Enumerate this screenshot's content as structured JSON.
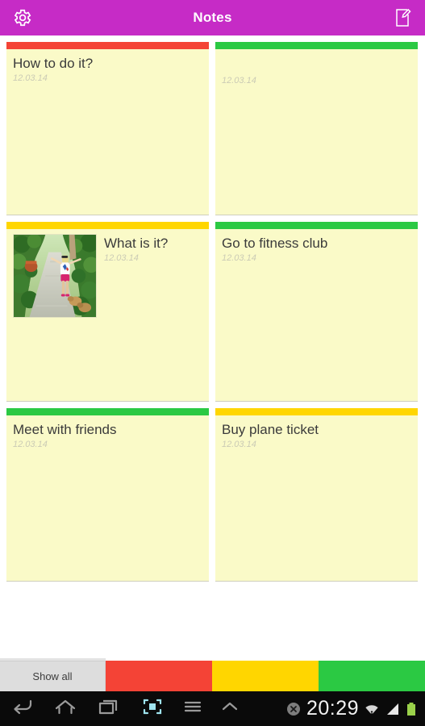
{
  "header": {
    "title": "Notes",
    "settings_icon": "gear-icon",
    "compose_icon": "compose-note-icon",
    "background_color": "#C62BC6"
  },
  "notes": [
    {
      "title": "How to do it?",
      "date": "12.03.14",
      "color": "#F44336",
      "color_name": "red",
      "has_image": false
    },
    {
      "title": "",
      "date": "12.03.14",
      "color": "#2BC943",
      "color_name": "green",
      "has_image": false
    },
    {
      "title": "What is it?",
      "date": "12.03.14",
      "color": "#FFD600",
      "color_name": "yellow",
      "has_image": true,
      "image_alt": "woman walking down a sunlit garden path with dogs"
    },
    {
      "title": "Go to fitness club",
      "date": "12.03.14",
      "color": "#2BC943",
      "color_name": "green",
      "has_image": false
    },
    {
      "title": "Meet with friends",
      "date": "12.03.14",
      "color": "#2BC943",
      "color_name": "green",
      "has_image": false
    },
    {
      "title": "Buy plane ticket",
      "date": "12.03.14",
      "color": "#FFD600",
      "color_name": "yellow",
      "has_image": false
    }
  ],
  "filter_bar": {
    "show_all_label": "Show all",
    "filters": [
      {
        "color_name": "red",
        "color": "#F44336"
      },
      {
        "color_name": "yellow",
        "color": "#FFD600"
      },
      {
        "color_name": "green",
        "color": "#2BC943"
      }
    ]
  },
  "system_bar": {
    "nav_keys": [
      {
        "name": "back-button"
      },
      {
        "name": "home-button"
      },
      {
        "name": "recents-button"
      },
      {
        "name": "screenshot-button"
      },
      {
        "name": "menu-button"
      },
      {
        "name": "expand-up-button"
      }
    ],
    "clock": "20:29",
    "status_icons": [
      "close-notification-icon",
      "wifi-icon",
      "signal-icon",
      "battery-icon"
    ]
  }
}
